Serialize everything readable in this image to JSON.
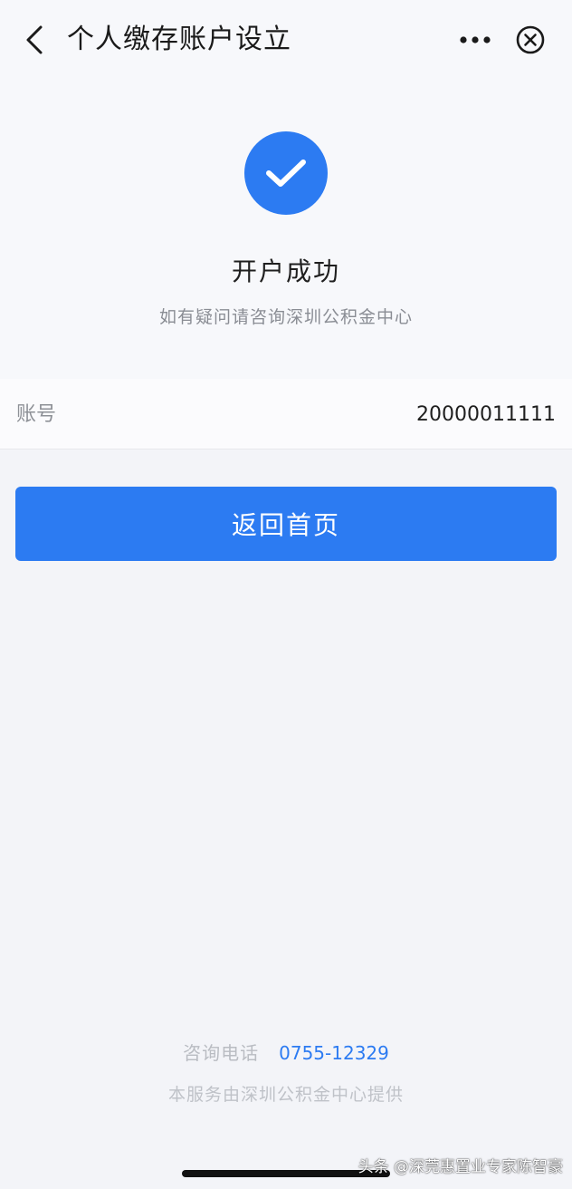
{
  "header": {
    "title": "个人缴存账户设立",
    "back_icon": "chevron-left-icon",
    "more_icon": "more-dots-icon",
    "close_icon": "close-circle-icon"
  },
  "result": {
    "icon": "check-circle-icon",
    "title": "开户成功",
    "subtitle": "如有疑问请咨询深圳公积金中心"
  },
  "account": {
    "label": "账号",
    "value": "20000011111"
  },
  "actions": {
    "home_label": "返回首页"
  },
  "footer": {
    "hotline_label": "咨询电话",
    "hotline_number": "0755-12329",
    "provider": "本服务由深圳公积金中心提供"
  },
  "watermark": "头条 @深莞惠置业专家陈智豪",
  "colors": {
    "accent": "#2c7bf2",
    "background": "#f3f4f8"
  }
}
